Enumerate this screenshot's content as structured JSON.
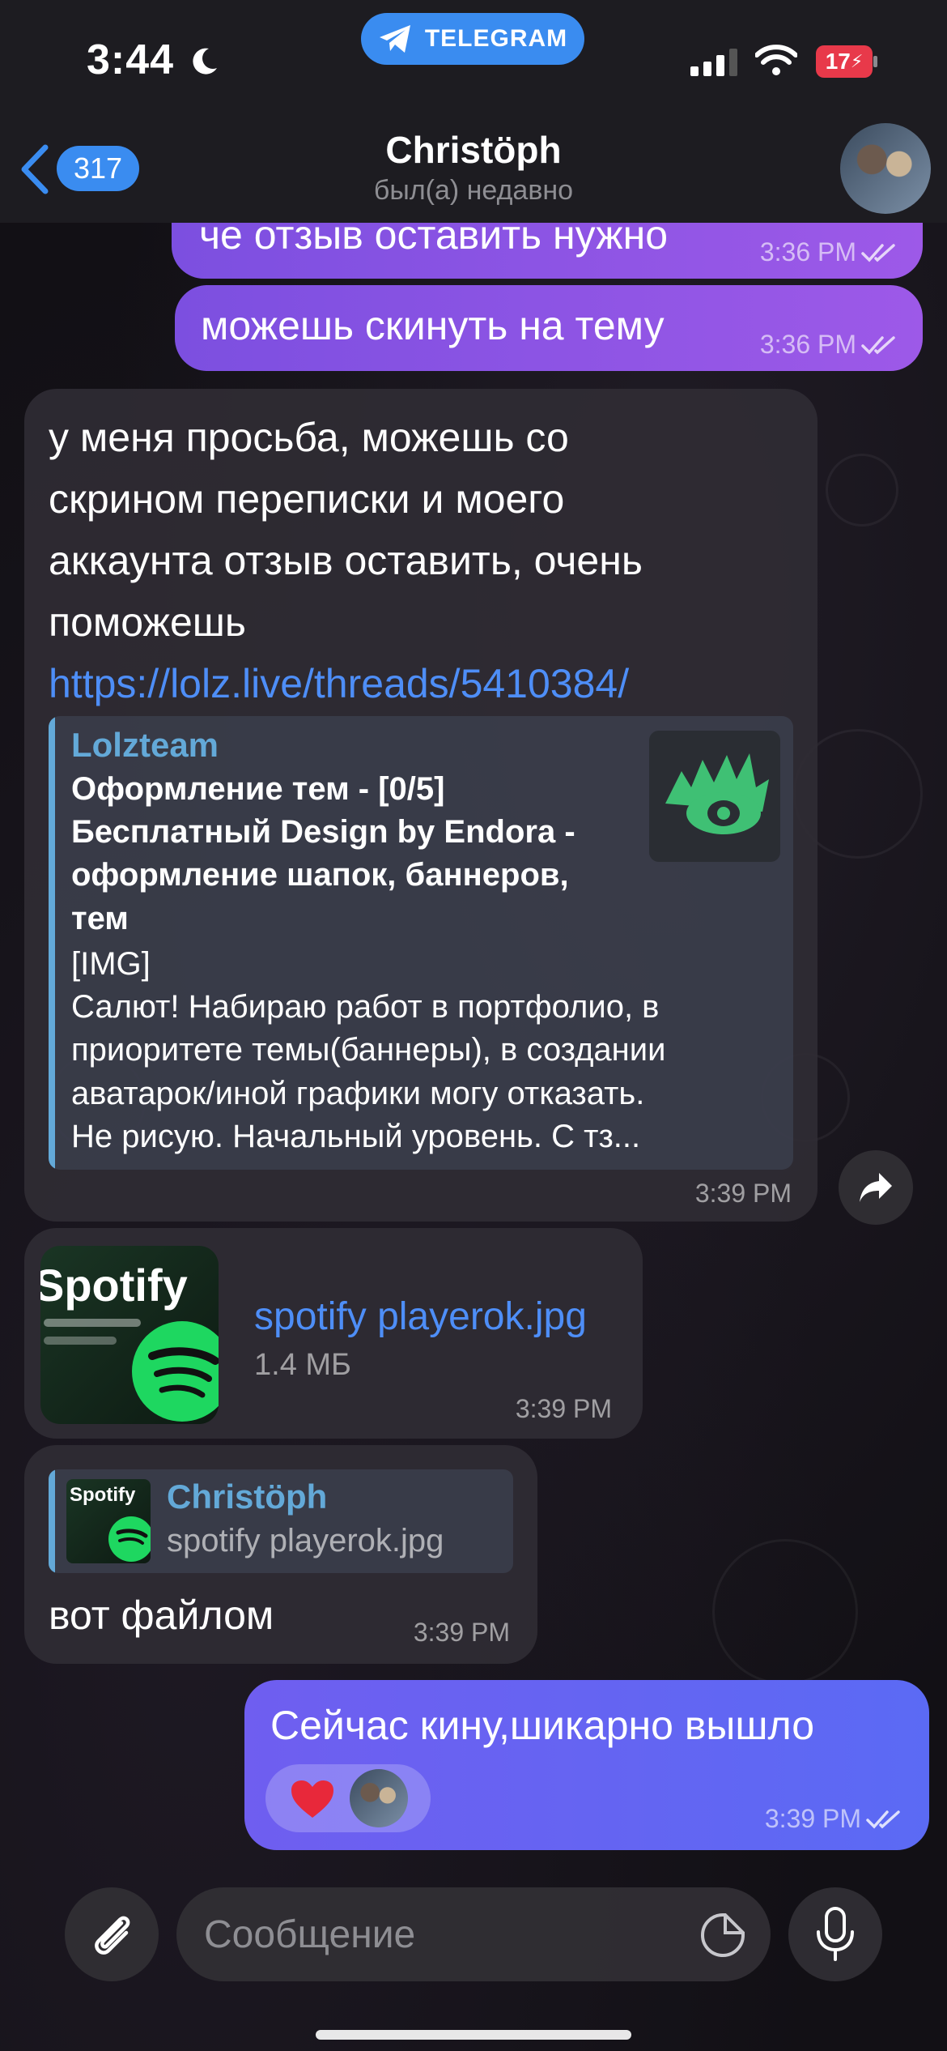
{
  "status_bar": {
    "time": "3:44",
    "app_pill": "TELEGRAM",
    "battery": "17"
  },
  "header": {
    "back_count": "317",
    "contact_name": "Christöph",
    "contact_status": "был(а) недавно"
  },
  "messages": [
    {
      "text": "че отзыв оставить нужно",
      "time": "3:36 PM"
    },
    {
      "text": "можешь скинуть на тему",
      "time": "3:36 PM"
    },
    {
      "lines": [
        "у меня просьба, можешь со",
        "скрином переписки и моего",
        "аккаунта отзыв оставить, очень",
        "поможешь"
      ],
      "link": "https://lolz.live/threads/5410384/",
      "preview": {
        "site": "Lolzteam",
        "title_lines": [
          "Оформление тем - [0/5]",
          "Бесплатный Design by Endora -",
          "оформление шапок, баннеров,",
          "тем"
        ],
        "body_lines": [
          "[IMG]",
          "Салют! Набираю работ в портфолио, в",
          "приоритете темы(баннеры), в создании",
          "аватарок/иной графики могу отказать.",
          "Не рисую. Начальный уровень. С тз..."
        ]
      },
      "time": "3:39 PM"
    },
    {
      "file_name": "spotify playerok.jpg",
      "file_size": "1.4 МБ",
      "thumb_text": "Spotify",
      "time": "3:39 PM"
    },
    {
      "reply_author": "Christöph",
      "reply_text": "spotify playerok.jpg",
      "reply_thumb_text": "Spotify",
      "text": "вот файлом",
      "time": "3:39 PM"
    },
    {
      "text": "Сейчас кину,шикарно вышло",
      "time": "3:39 PM",
      "reaction": "heart"
    }
  ],
  "composer": {
    "placeholder": "Сообщение"
  },
  "colors": {
    "accent": "#3a8cf0",
    "outgoing": "#8a55e6",
    "link": "#4e8ef7"
  }
}
